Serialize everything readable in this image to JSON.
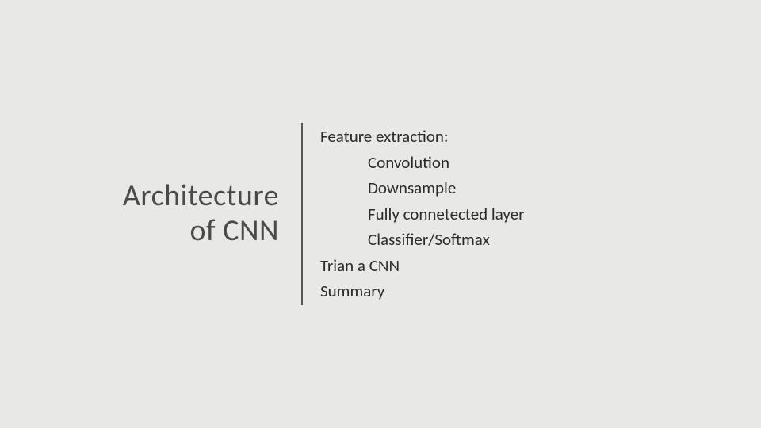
{
  "title": {
    "line1": "Architecture",
    "line2": "of CNN"
  },
  "content": {
    "heading1": "Feature extraction:",
    "sub1": "Convolution",
    "sub2": "Downsample",
    "sub3": "Fully connetected layer",
    "sub4": "Classifier/Softmax",
    "line2": "Trian a CNN",
    "line3": "Summary"
  }
}
